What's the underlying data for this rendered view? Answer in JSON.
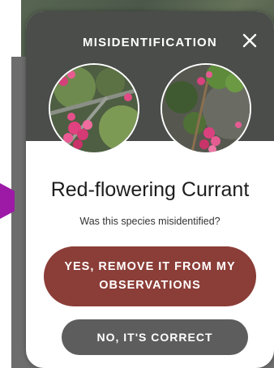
{
  "modal": {
    "title": "MISIDENTIFICATION",
    "species_name": "Red-flowering Currant",
    "question": "Was this species misidentified?",
    "confirm_label": "YES, REMOVE IT FROM MY OBSERVATIONS",
    "deny_label": "NO, IT'S CORRECT",
    "close_icon": "close-icon"
  },
  "colors": {
    "header_bg": "#4a4d4a",
    "confirm_bg": "#8b3d37",
    "deny_bg": "#5d5d5d",
    "accent_purple": "#9c1aa6"
  }
}
